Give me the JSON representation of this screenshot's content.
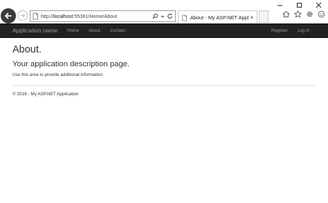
{
  "browser": {
    "address": {
      "scheme": "http://",
      "host": "localhost",
      "path": ":55361/Home/About"
    },
    "tab": {
      "title": "About - My ASP.NET Appli...",
      "close_glyph": "×"
    },
    "icons": [
      "back-arrow-icon",
      "forward-arrow-icon",
      "page-icon",
      "search-icon",
      "dropdown-icon",
      "refresh-icon",
      "home-icon",
      "favorites-star-icon",
      "settings-gear-icon",
      "smiley-icon"
    ]
  },
  "navbar": {
    "brand": "Application name",
    "links": [
      "Home",
      "About",
      "Contact"
    ],
    "right_links": [
      "Register",
      "Log in"
    ],
    "background": "#222222",
    "link_color": "#9d9d9d"
  },
  "main": {
    "title": "About.",
    "subtitle": "Your application description page.",
    "description": "Use this area to provide additional information."
  },
  "footer": {
    "text": "© 2016 - My ASP.NET Application"
  }
}
